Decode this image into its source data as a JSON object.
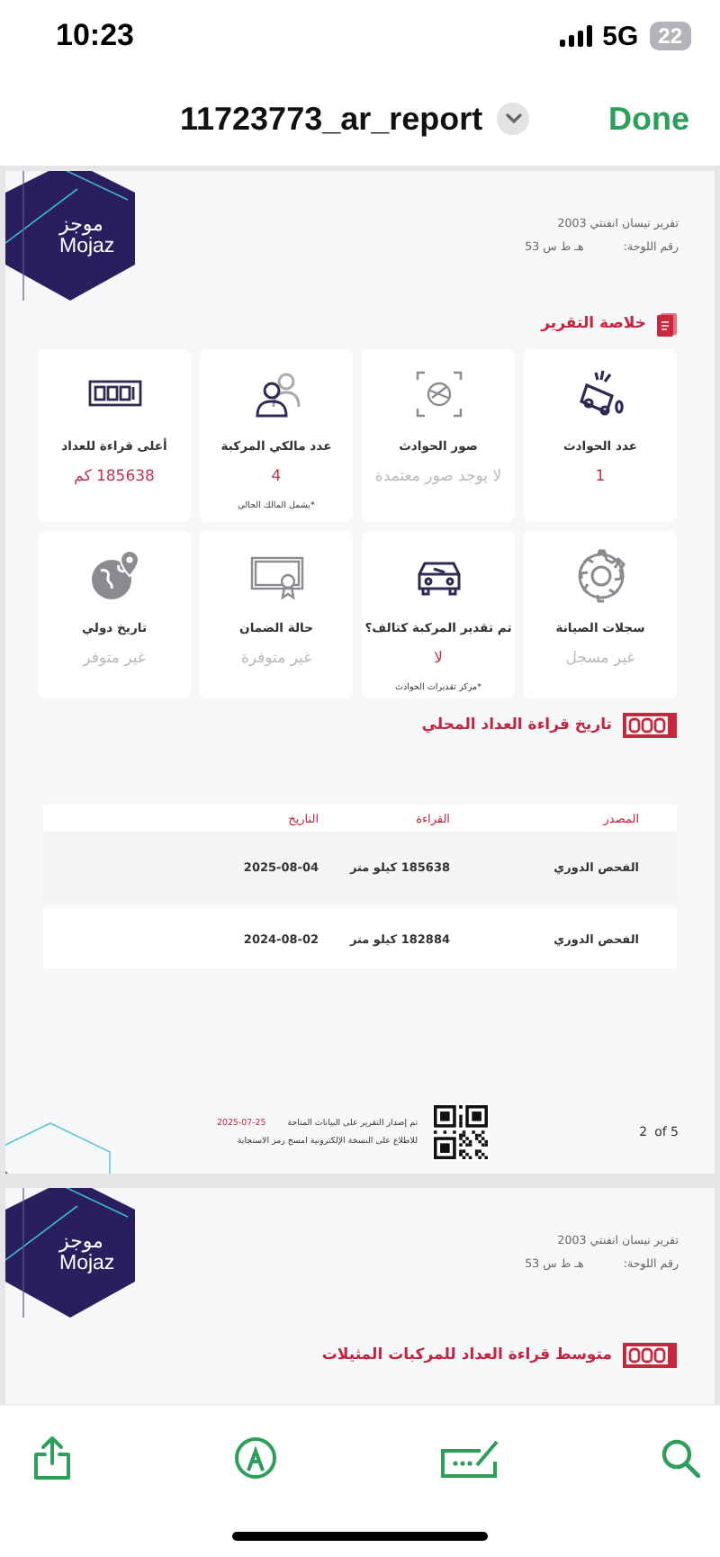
{
  "status_bar": {
    "time": "10:23",
    "network": "5G",
    "battery": "22"
  },
  "nav": {
    "title": "11723773_ar_report",
    "done": "Done"
  },
  "pages": [
    {
      "logo": {
        "arabic": "موجز",
        "latin": "Mojaz"
      },
      "vehicle": "تقرير نيسان انفنتي 2003",
      "plate_label": "رقم اللوحة:",
      "plate": "هـ ط س 53",
      "sections": [
        {
          "kind": "summary",
          "title": "خلاصة التقرير",
          "cards": [
            {
              "title": "عدد الحوادث",
              "value": "1",
              "muted": false
            },
            {
              "title": "صور الحوادث",
              "value": "لا يوجد صور معتمدة",
              "muted": true
            },
            {
              "title": "عدد مالكي المركبة",
              "value": "4",
              "muted": false,
              "note": "*يشمل المالك الحالي"
            },
            {
              "title": "أعلى قراءة للعداد",
              "value": "185638 كم",
              "muted": false
            },
            {
              "title": "سجلات الصيانة",
              "value": "غير مسجل",
              "muted": true
            },
            {
              "title": "تم تقدير المركبة كتالف؟",
              "value": "لا",
              "muted": false,
              "note": "*مركز تقديرات الحوادث"
            },
            {
              "title": "حالة الضمان",
              "value": "غير متوفرة",
              "muted": true
            },
            {
              "title": "تاريخ دولي",
              "value": "غير متوفر",
              "muted": true
            }
          ]
        },
        {
          "kind": "odometer_history",
          "title": "تاريخ قراءة العداد المحلي",
          "columns": [
            "المصدر",
            "القراءة",
            "التاريخ"
          ],
          "rows": [
            [
              "الفحص الدوري",
              "185638 كيلو متر",
              "2025-08-04"
            ],
            [
              "الفحص الدوري",
              "182884 كيلو متر",
              "2024-08-02"
            ]
          ]
        }
      ],
      "footer": {
        "issued": "تم إصدار التقرير على البيانات المتاحة",
        "date": "2025-07-25",
        "scan_hint": "للاطلاع على النسخة الإلكترونية امسح رمز الاستجابة",
        "page": "2",
        "of": "of 5"
      }
    },
    {
      "logo": {
        "arabic": "موجز",
        "latin": "Mojaz"
      },
      "vehicle": "تقرير نيسان انفنتي 2003",
      "plate_label": "رقم اللوحة:",
      "plate": "هـ ط س 53",
      "sections": [
        {
          "kind": "average",
          "title": "متوسط قراءة العداد للمركبات المثيلات"
        }
      ]
    }
  ]
}
